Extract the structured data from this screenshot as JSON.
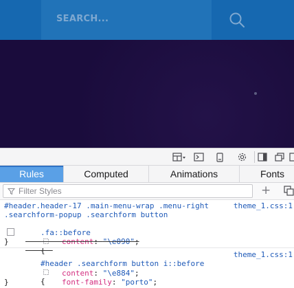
{
  "site": {
    "search_placeholder": "SEARCH..."
  },
  "devtools": {
    "tabs": [
      {
        "label": "Rules",
        "active": true
      },
      {
        "label": "Computed",
        "active": false
      },
      {
        "label": "Animations",
        "active": false
      },
      {
        "label": "Fonts",
        "active": false
      }
    ],
    "filter_placeholder": "Filter Styles",
    "add_rule_label": "+",
    "rule1": {
      "selector_line1": "#header.header-17 .main-menu-wrap .menu-right",
      "selector_line2": ".searchform-popup .searchform button",
      "selector_line3": ".fa::before",
      "open_brace": "{",
      "source": "theme_1.css:1",
      "decl_property": "content",
      "decl_colon": ":",
      "decl_value": "\"\\e090\"",
      "decl_semicolon": ";",
      "close_brace": "}"
    },
    "rule2": {
      "selector": "#header .searchform button i::before",
      "open_brace": "{",
      "source": "theme_1.css:1",
      "decl1_property": "content",
      "decl1_value": "\"\\e884\"",
      "decl2_property": "font-family",
      "decl2_value": "\"porto\"",
      "colon": ":",
      "semicolon": ";",
      "close_brace": "}"
    }
  }
}
